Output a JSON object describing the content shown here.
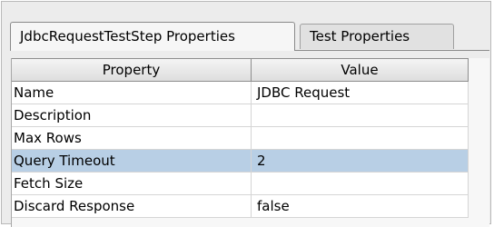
{
  "tabs": [
    {
      "label": "JdbcRequestTestStep Properties",
      "active": true
    },
    {
      "label": "Test Properties",
      "active": false
    }
  ],
  "table": {
    "headers": {
      "property": "Property",
      "value": "Value"
    },
    "rows": [
      {
        "property": "Name",
        "value": "JDBC Request"
      },
      {
        "property": "Description",
        "value": ""
      },
      {
        "property": "Max Rows",
        "value": ""
      },
      {
        "property": "Query Timeout",
        "value": "2",
        "selected": true
      },
      {
        "property": "Fetch Size",
        "value": ""
      },
      {
        "property": "Discard Response",
        "value": "false"
      }
    ]
  },
  "colors": {
    "selected_row": "#b8cfe5",
    "panel_background": "#ececec",
    "grid_line": "#d5d5d5"
  }
}
